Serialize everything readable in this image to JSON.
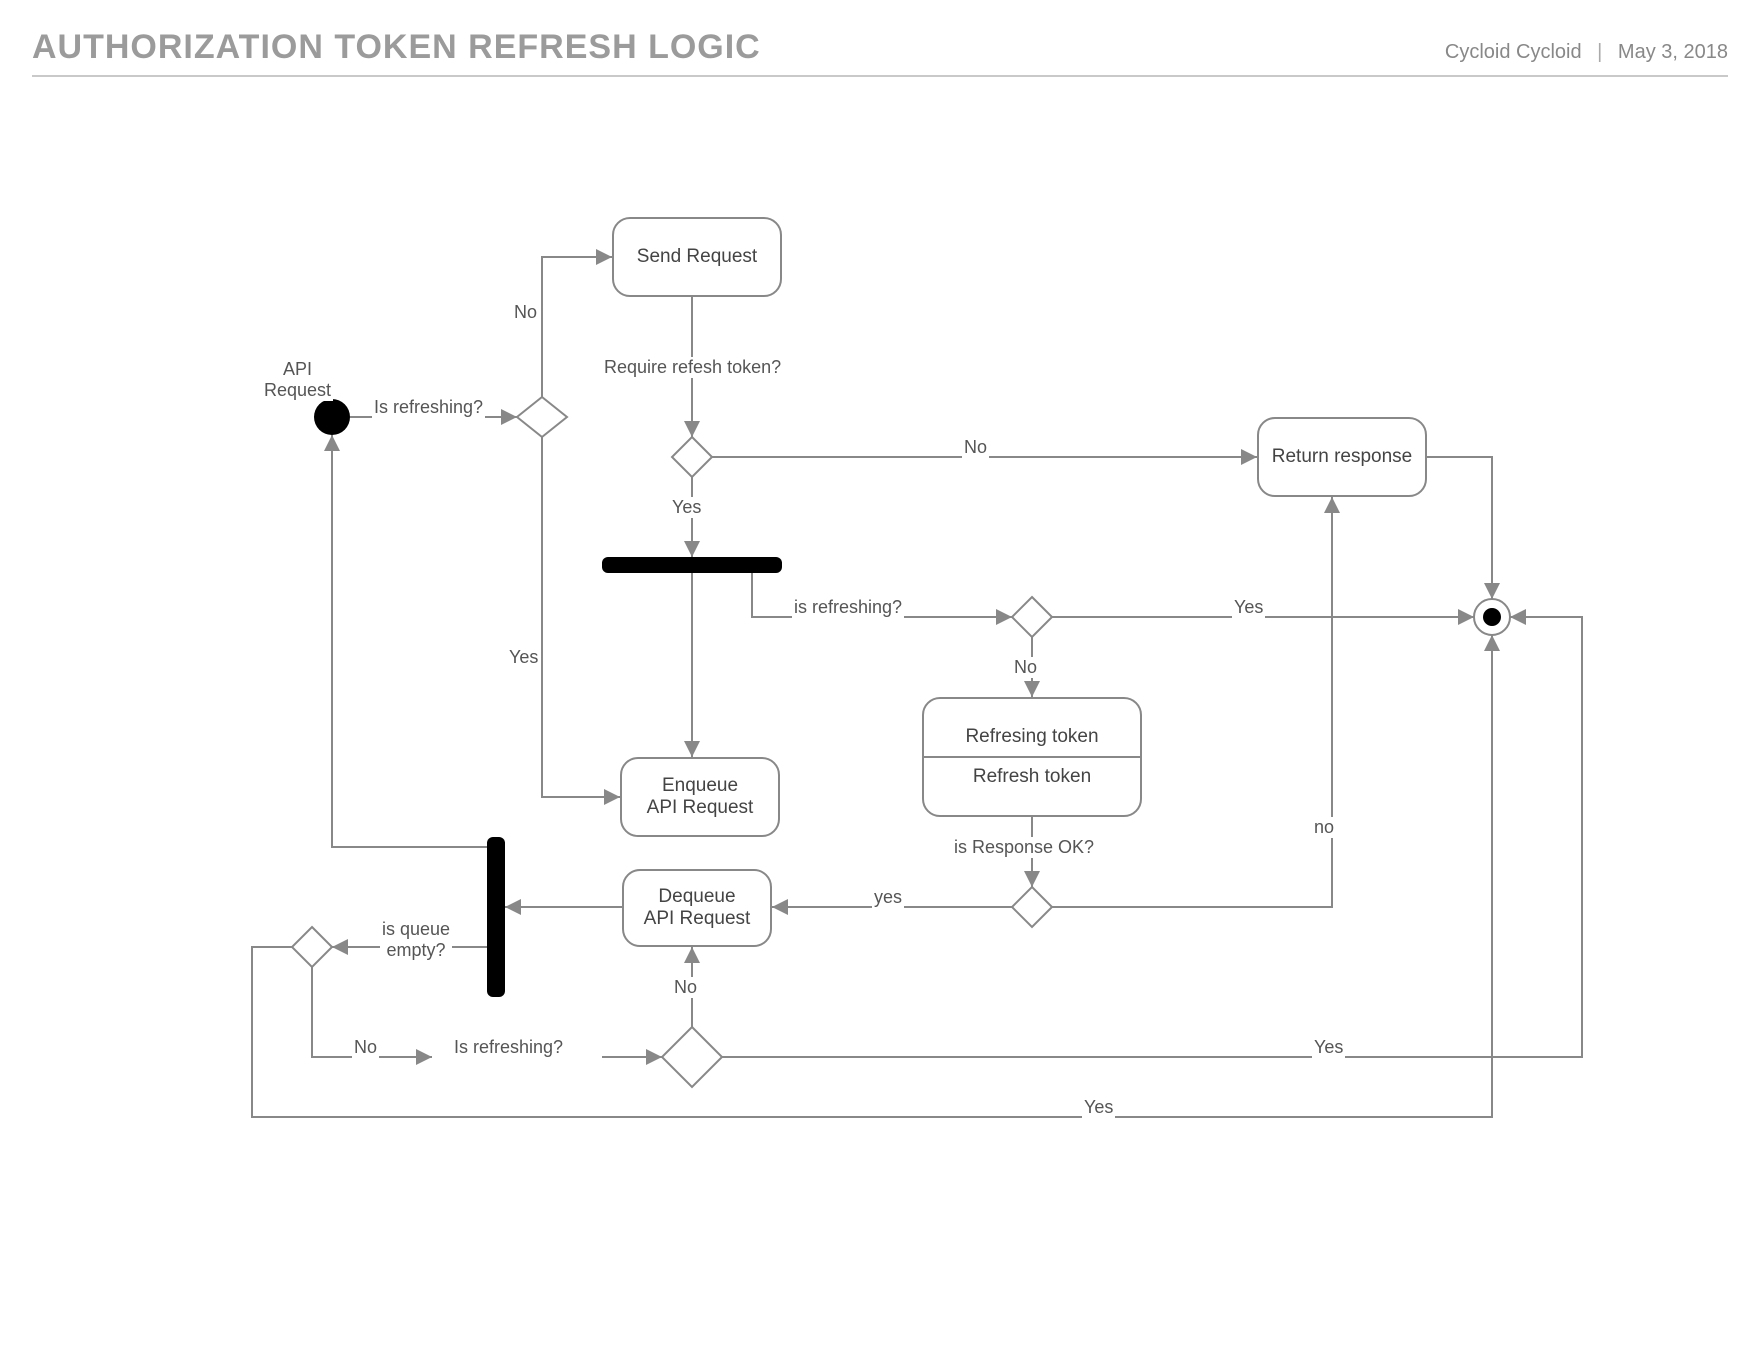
{
  "header": {
    "title": "AUTHORIZATION TOKEN REFRESH LOGIC",
    "author": "Cycloid Cycloid",
    "date": "May 3, 2018"
  },
  "labels": {
    "api_request": "API\nRequest",
    "is_refreshing_1": "Is refreshing?",
    "no_1": "No",
    "yes_1": "Yes",
    "require_refresh": "Require refesh token?",
    "no_2": "No",
    "yes_2": "Yes",
    "is_refreshing_2": "is refreshing?",
    "yes_3": "Yes",
    "no_3": "No",
    "is_response_ok": "is Response OK?",
    "yes_lower": "yes",
    "no_lower": "no",
    "is_queue_empty": "is queue\nempty?",
    "no_4": "No",
    "is_refreshing_3": "Is refreshing?",
    "no_5": "No",
    "yes_4": "Yes",
    "yes_5": "Yes"
  },
  "nodes": {
    "send_request": "Send Request",
    "return_response": "Return response",
    "enqueue": "Enqueue\nAPI Request",
    "dequeue": "Dequeue\nAPI Request",
    "refreshing_header": "Refresing token",
    "refreshing_body": "Refresh token"
  }
}
